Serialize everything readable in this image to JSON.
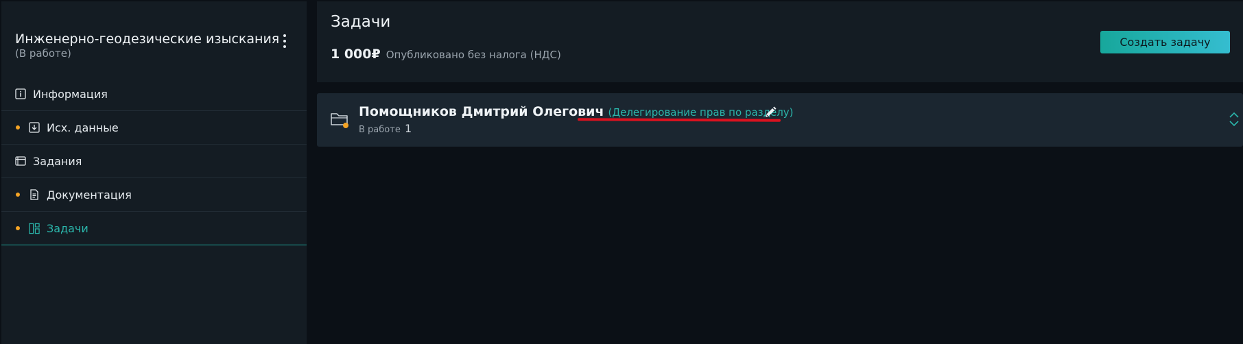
{
  "sidebar": {
    "project_title": "Инженерно-геодезические изыскания",
    "project_status": "(В работе)",
    "items": [
      {
        "label": "Информация",
        "icon": "info-icon",
        "dot": false,
        "active": false
      },
      {
        "label": "Исх. данные",
        "icon": "download-icon",
        "dot": true,
        "active": false
      },
      {
        "label": "Задания",
        "icon": "window-icon",
        "dot": false,
        "active": false
      },
      {
        "label": "Документация",
        "icon": "document-icon",
        "dot": true,
        "active": false
      },
      {
        "label": "Задачи",
        "icon": "dashboard-icon",
        "dot": true,
        "active": true
      }
    ]
  },
  "header": {
    "title": "Задачи",
    "price": "1 000₽",
    "price_note": "Опубликовано без налога (НДС)",
    "create_button": "Создать задачу"
  },
  "task": {
    "name": "Помощников Дмитрий Олегович",
    "role": "(Делегирование прав по разделу)",
    "status_label": "В работе",
    "status_count": "1"
  },
  "colors": {
    "accent": "#2bb6ab",
    "status_dot": "#f5a425",
    "annotation": "#d9121f"
  }
}
